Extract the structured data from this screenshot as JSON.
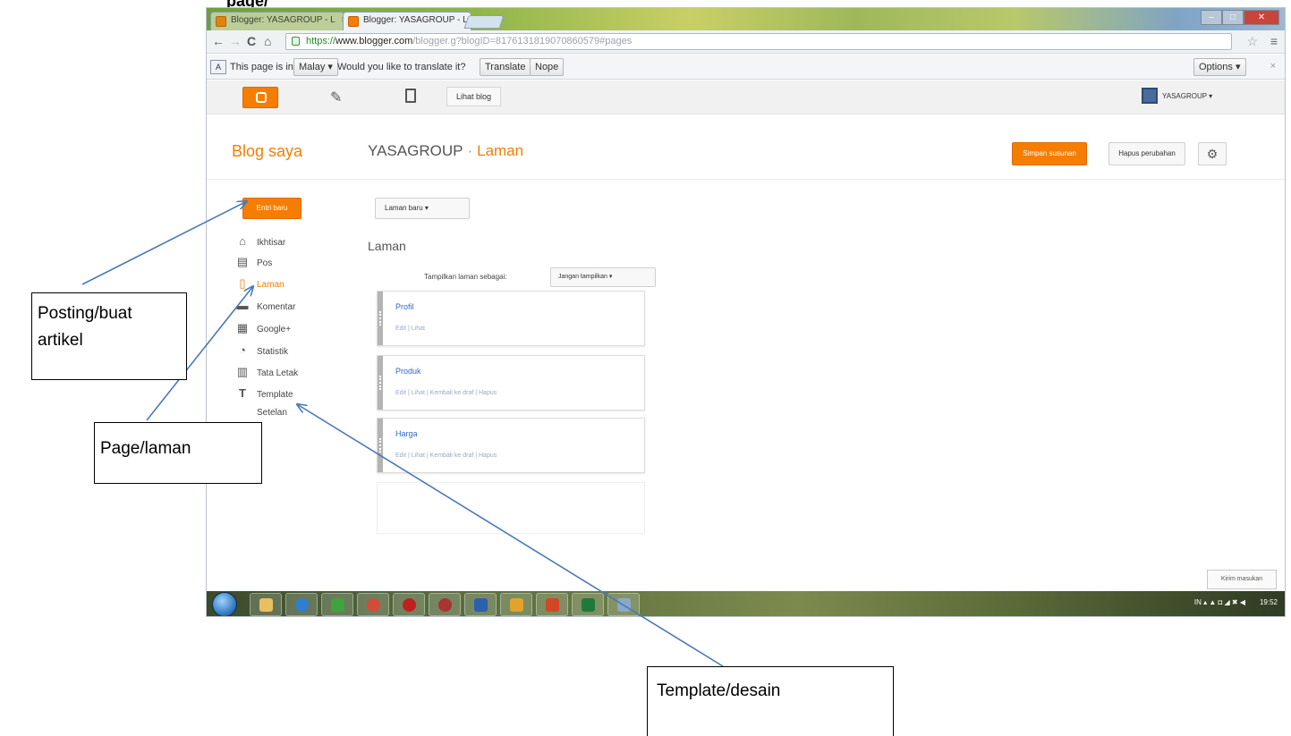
{
  "doc": {
    "heading_fragment": "page/"
  },
  "browser": {
    "tabs": [
      {
        "label": "Blogger: YASAGROUP - L",
        "close": "×"
      },
      {
        "label": "Blogger: YASAGROUP - L",
        "close": "×"
      }
    ],
    "window_controls": {
      "minimize": "–",
      "maximize": "□",
      "close": "✕"
    },
    "nav": {
      "back": "←",
      "forward": "→",
      "reload": "C",
      "home": "⌂"
    },
    "url": {
      "scheme": "https://",
      "host": "www.blogger.com",
      "path": "/blogger.g?blogID=8176131819070860579#pages"
    },
    "star": "☆",
    "menu": "≡",
    "translate_bar": {
      "icon_text": "A",
      "prefix": "This page is in",
      "language": "Malay ▾",
      "question": "Would you like to translate it?",
      "translate": "Translate",
      "nope": "Nope",
      "options": "Options ▾",
      "close": "×"
    }
  },
  "blogger": {
    "topbar": {
      "view_blog": "Lihat blog",
      "user": "YASAGROUP ▾",
      "pencil": "✎"
    },
    "header": {
      "blog_saya": "Blog saya",
      "blog_name": "YASAGROUP",
      "separator": "·",
      "current": "Laman",
      "save_btn": "Simpan susunan",
      "revert_btn": "Hapus perubahan",
      "gear": "⚙"
    },
    "sidebar": {
      "new_post": "Entri baru",
      "items": [
        {
          "label": "Ikhtisar",
          "icon": "⌂"
        },
        {
          "label": "Pos",
          "icon": "▤"
        },
        {
          "label": "Laman",
          "icon": "▯"
        },
        {
          "label": "Komentar",
          "icon": "▬"
        },
        {
          "label": "Google+",
          "icon": "▦"
        },
        {
          "label": "Statistik",
          "icon": "◔"
        },
        {
          "label": "Tata Letak",
          "icon": "▥"
        },
        {
          "label": "Template",
          "icon": "T"
        },
        {
          "label": "Setelan",
          "icon": ""
        }
      ]
    },
    "main": {
      "new_page_btn": "Laman baru ▾",
      "title": "Laman",
      "display_label": "Tampilkan laman sebagai:",
      "display_value": "Jangan tampilkan ▾",
      "pages": [
        {
          "title": "Profil",
          "links": "Edit | Lihat"
        },
        {
          "title": "Produk",
          "links": "Edit | Lihat | Kembali ke draf | Hapus"
        },
        {
          "title": "Harga",
          "links": "Edit | Lihat | Kembali ke draf | Hapus"
        }
      ],
      "feedback": "Kirim masukan"
    },
    "taskbar": {
      "tray": "IN ▴ ▲ ◘ ◢ ✖ ◀",
      "clock": "19:52"
    }
  },
  "annotations": {
    "posting": [
      "Posting/buat",
      "artikel"
    ],
    "page": "Page/laman",
    "template": "Template/desain"
  }
}
